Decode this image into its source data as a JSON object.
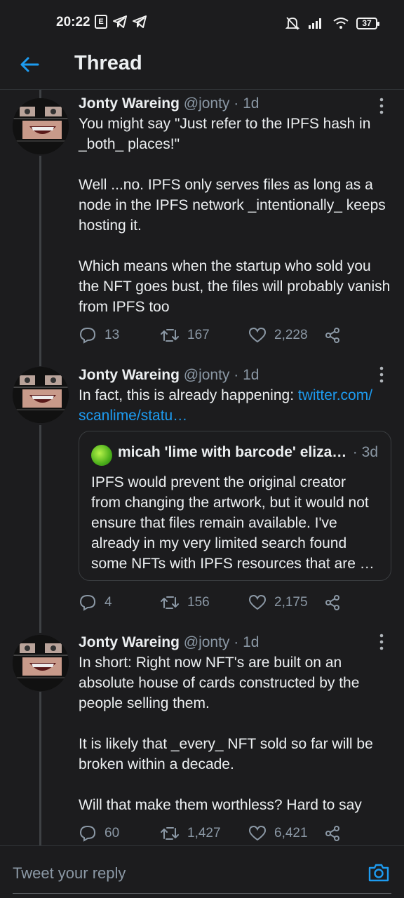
{
  "status_bar": {
    "time": "20:22",
    "notif_box": "E",
    "battery": "37"
  },
  "header": {
    "title": "Thread",
    "back_icon": "arrow-left-icon"
  },
  "tweets": [
    {
      "name": "Jonty Wareing",
      "handle": "@jonty",
      "dot": "·",
      "time": "1d",
      "text": "You might say \"Just refer to the IPFS hash in _both_ places!\"\n\nWell ...no. IPFS only serves files as long as a node in the IPFS network _intentionally_ keeps hosting it.\n\nWhich means when the startup who sold you the NFT goes bust, the files will probably vanish from IPFS too",
      "replies": "13",
      "retweets": "167",
      "likes": "2,228"
    },
    {
      "name": "Jonty Wareing",
      "handle": "@jonty",
      "dot": "·",
      "time": "1d",
      "text": "In fact, this is already happening: ",
      "link": "twitter.com/\nscanlime/statu…",
      "quote": {
        "name": "micah 'lime with barcode' elizab…",
        "dot": "·",
        "time": "3d",
        "text": "IPFS would prevent the original creator from changing the artwork, but it would not ensure that files remain available. I've already in my very limited search found some NFTs with IPFS resources that are …"
      },
      "replies": "4",
      "retweets": "156",
      "likes": "2,175"
    },
    {
      "name": "Jonty Wareing",
      "handle": "@jonty",
      "dot": "·",
      "time": "1d",
      "text": "In short: Right now NFT's are built on an absolute house of cards constructed by the people selling them.\n\nIt is likely that _every_ NFT sold so far will be broken within a decade.\n\nWill that make them worthless? Hard to say",
      "replies": "60",
      "retweets": "1,427",
      "likes": "6,421"
    }
  ],
  "reply_bar": {
    "placeholder": "Tweet your reply",
    "camera_icon": "camera-icon"
  },
  "colors": {
    "background": "#1c1c1e",
    "accent": "#1d9bf0",
    "muted": "#8b98a5",
    "text": "#eceff1"
  }
}
